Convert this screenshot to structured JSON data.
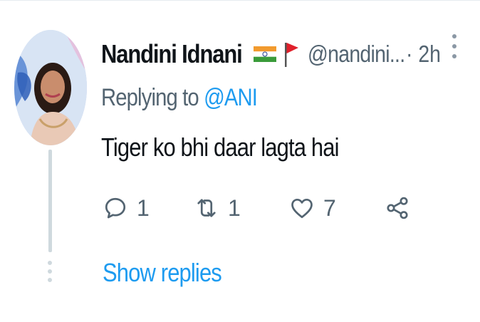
{
  "tweet": {
    "author_name": "Nandini Idnani",
    "handle": "@nandini...",
    "time": "· 2h",
    "replying_prefix": "Replying to ",
    "replying_to": "@ANI",
    "text": "Tiger ko bhi daar lagta hai"
  },
  "actions": {
    "reply_count": "1",
    "retweet_count": "1",
    "like_count": "7"
  },
  "show_replies_label": "Show replies",
  "icons": {
    "flag": "india-flag-icon",
    "flag2": "red-flag-icon",
    "more": "more-vertical-icon",
    "reply": "reply-icon",
    "retweet": "retweet-icon",
    "like": "heart-icon",
    "share": "share-icon"
  },
  "colors": {
    "accent": "#1d9bf0",
    "secondary_text": "#536471",
    "thread_line": "#cfd9de"
  }
}
